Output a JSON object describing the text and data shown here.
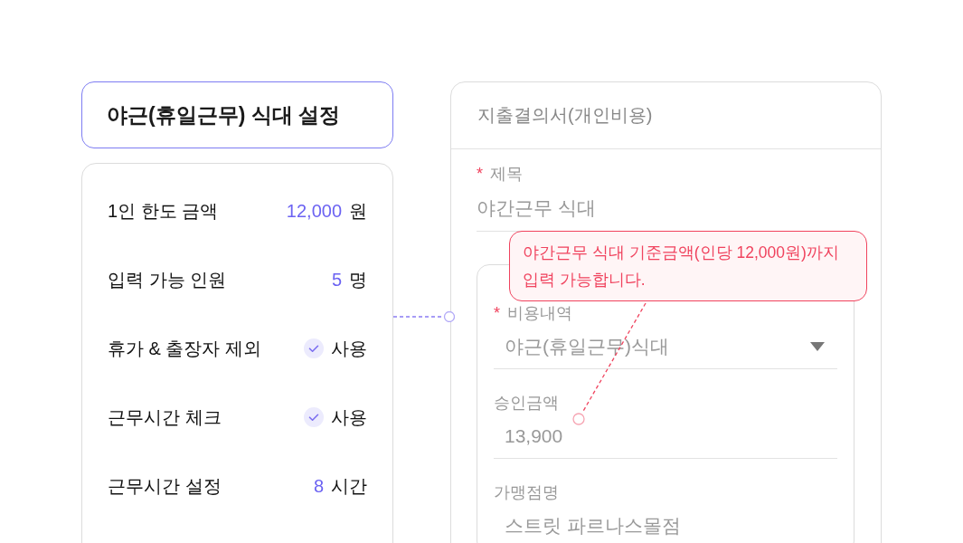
{
  "settings": {
    "title": "야근(휴일근무) 식대 설정",
    "rows": [
      {
        "kind": "amount",
        "label": "1인 한도 금액",
        "value": "12,000",
        "unit": "원"
      },
      {
        "kind": "amount",
        "label": "입력 가능 인원",
        "value": "5",
        "unit": "명"
      },
      {
        "kind": "check",
        "label": "휴가 & 출장자 제외",
        "checked": true,
        "option": "사용"
      },
      {
        "kind": "check",
        "label": "근무시간 체크",
        "checked": true,
        "option": "사용"
      },
      {
        "kind": "amount",
        "label": "근무시간 설정",
        "value": "8",
        "unit": "시간"
      }
    ]
  },
  "form": {
    "title": "지출결의서(개인비용)",
    "subject": {
      "label": "제목",
      "required_mark": "*",
      "value": "야간근무 식대"
    },
    "expense_fields": [
      {
        "kind": "select",
        "label": "비용내역",
        "required_mark": "*",
        "value": "야근(휴일근무)식대"
      },
      {
        "kind": "text",
        "label": "승인금액",
        "value": "13,900"
      },
      {
        "kind": "text",
        "label": "가맹점명",
        "value": "스트릿 파르나스몰점"
      }
    ]
  },
  "tooltip": {
    "text": "야간근무 식대 기준금액(인당 12,000원)까지 입력 가능합니다."
  }
}
